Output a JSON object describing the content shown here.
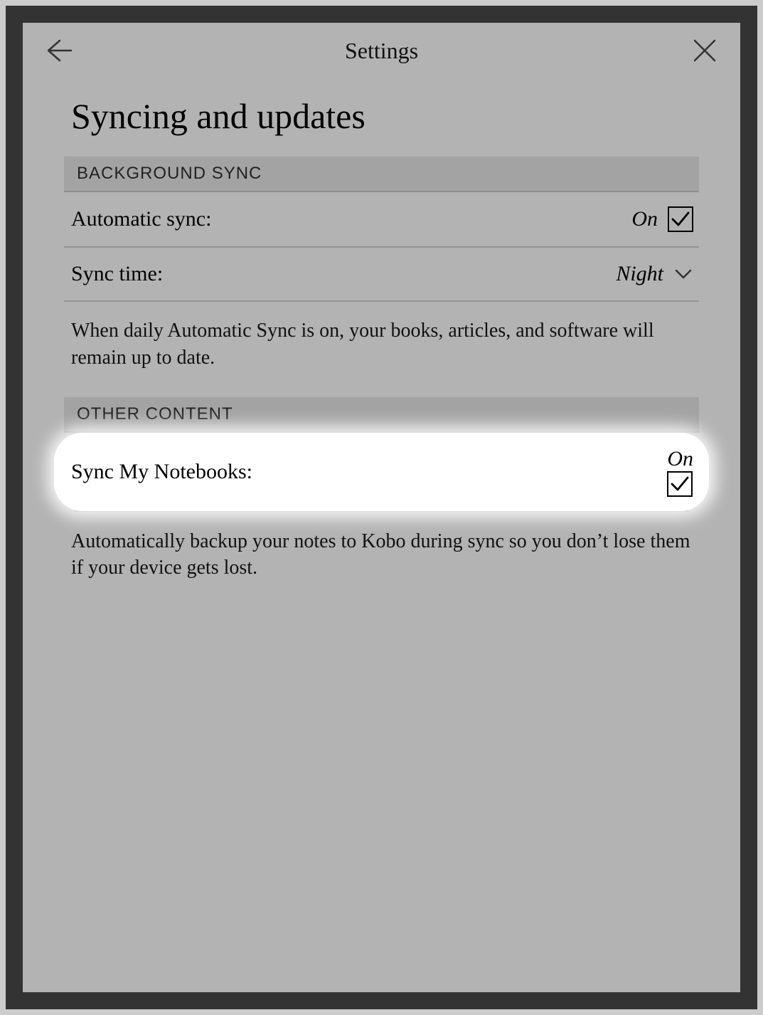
{
  "header": {
    "title": "Settings"
  },
  "page": {
    "title": "Syncing and updates"
  },
  "sections": {
    "background_sync": {
      "header": "BACKGROUND SYNC",
      "automatic_sync": {
        "label": "Automatic sync:",
        "value": "On"
      },
      "sync_time": {
        "label": "Sync time:",
        "value": "Night"
      },
      "description": "When daily Automatic Sync is on, your books, articles, and software will remain up to date."
    },
    "other_content": {
      "header": "OTHER CONTENT",
      "sync_notebooks": {
        "label": "Sync My Notebooks:",
        "value": "On"
      },
      "description": "Automatically backup your notes to Kobo during sync so you don’t lose them if your device gets lost."
    }
  }
}
